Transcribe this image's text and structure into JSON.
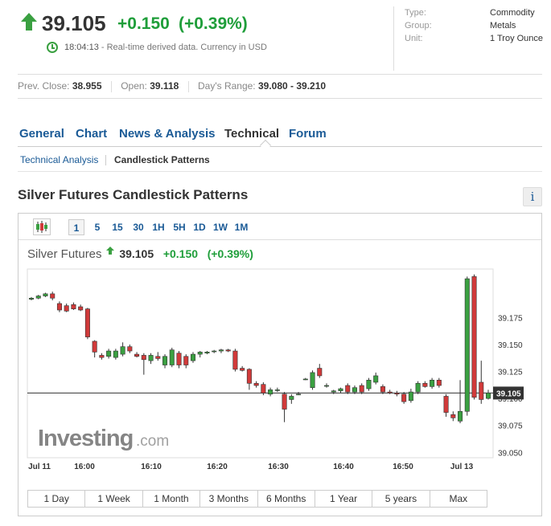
{
  "quote": {
    "price": "39.105",
    "change": "+0.150",
    "change_pct": "(+0.39%)",
    "time": "18:04:13",
    "time_note": " - Real-time derived data. Currency in USD"
  },
  "meta": [
    {
      "key": "Type:",
      "value": "Commodity"
    },
    {
      "key": "Group:",
      "value": "Metals"
    },
    {
      "key": "Unit:",
      "value": "1 Troy Ounce"
    }
  ],
  "stats": {
    "prev_close_label": "Prev. Close:",
    "prev_close": "38.955",
    "open_label": "Open:",
    "open": "39.118",
    "range_label": "Day's Range:",
    "range": "39.080 - 39.210"
  },
  "tabs": [
    "General",
    "Chart",
    "News & Analysis",
    "Technical",
    "Forum"
  ],
  "subtabs": {
    "analysis": "Technical Analysis",
    "patterns": "Candlestick Patterns"
  },
  "section_title": "Silver Futures Candlestick Patterns",
  "info_label": "i",
  "toolbar": {
    "periods": [
      "1",
      "5",
      "15",
      "30",
      "1H",
      "5H",
      "1D",
      "1W",
      "1M"
    ],
    "active": "1"
  },
  "legend": {
    "name": "Silver Futures",
    "price": "39.105",
    "change": "+0.150",
    "change_pct": "(+0.39%)"
  },
  "ranges": [
    "1 Day",
    "1 Week",
    "1 Month",
    "3 Months",
    "6 Months",
    "1 Year",
    "5 years",
    "Max"
  ],
  "colors": {
    "up": "#3aa041",
    "down": "#d13a3a",
    "text_up": "#1f9e3a",
    "link": "#1a5a96"
  },
  "chart_data": {
    "type": "candlestick",
    "title": "Silver Futures",
    "ylim": [
      39.045,
      39.22
    ],
    "yticks": [
      "39.175",
      "39.150",
      "39.125",
      "39.100",
      "39.075",
      "39.050"
    ],
    "current_price": "39.105",
    "watermark": "Investing.com",
    "xticks": [
      "Jul 11",
      "16:00",
      "16:10",
      "16:20",
      "16:30",
      "16:40",
      "16:50",
      "Jul 13"
    ],
    "candles": [
      {
        "o": 39.192,
        "h": 39.194,
        "l": 39.191,
        "c": 39.193
      },
      {
        "o": 39.193,
        "h": 39.196,
        "l": 39.192,
        "c": 39.195
      },
      {
        "o": 39.195,
        "h": 39.198,
        "l": 39.194,
        "c": 39.197
      },
      {
        "o": 39.197,
        "h": 39.199,
        "l": 39.191,
        "c": 39.193
      },
      {
        "o": 39.188,
        "h": 39.19,
        "l": 39.18,
        "c": 39.182
      },
      {
        "o": 39.186,
        "h": 39.188,
        "l": 39.18,
        "c": 39.181
      },
      {
        "o": 39.187,
        "h": 39.189,
        "l": 39.182,
        "c": 39.183
      },
      {
        "o": 39.185,
        "h": 39.187,
        "l": 39.181,
        "c": 39.182
      },
      {
        "o": 39.183,
        "h": 39.184,
        "l": 39.155,
        "c": 39.157
      },
      {
        "o": 39.153,
        "h": 39.154,
        "l": 39.138,
        "c": 39.143
      },
      {
        "o": 39.14,
        "h": 39.142,
        "l": 39.136,
        "c": 39.138
      },
      {
        "o": 39.139,
        "h": 39.146,
        "l": 39.137,
        "c": 39.144
      },
      {
        "o": 39.138,
        "h": 39.146,
        "l": 39.136,
        "c": 39.144
      },
      {
        "o": 39.141,
        "h": 39.152,
        "l": 39.139,
        "c": 39.148
      },
      {
        "o": 39.148,
        "h": 39.15,
        "l": 39.142,
        "c": 39.144
      },
      {
        "o": 39.141,
        "h": 39.143,
        "l": 39.138,
        "c": 39.139
      },
      {
        "o": 39.14,
        "h": 39.142,
        "l": 39.122,
        "c": 39.136
      },
      {
        "o": 39.135,
        "h": 39.142,
        "l": 39.132,
        "c": 39.14
      },
      {
        "o": 39.139,
        "h": 39.143,
        "l": 39.135,
        "c": 39.137
      },
      {
        "o": 39.131,
        "h": 39.141,
        "l": 39.128,
        "c": 39.139
      },
      {
        "o": 39.131,
        "h": 39.147,
        "l": 39.129,
        "c": 39.145
      },
      {
        "o": 39.142,
        "h": 39.144,
        "l": 39.128,
        "c": 39.131
      },
      {
        "o": 39.139,
        "h": 39.141,
        "l": 39.128,
        "c": 39.131
      },
      {
        "o": 39.135,
        "h": 39.143,
        "l": 39.133,
        "c": 39.141
      },
      {
        "o": 39.141,
        "h": 39.144,
        "l": 39.138,
        "c": 39.143
      },
      {
        "o": 39.142,
        "h": 39.144,
        "l": 39.141,
        "c": 39.143
      },
      {
        "o": 39.144,
        "h": 39.145,
        "l": 39.142,
        "c": 39.144
      },
      {
        "o": 39.144,
        "h": 39.146,
        "l": 39.142,
        "c": 39.145
      },
      {
        "o": 39.145,
        "h": 39.146,
        "l": 39.143,
        "c": 39.144
      },
      {
        "o": 39.144,
        "h": 39.146,
        "l": 39.125,
        "c": 39.127
      },
      {
        "o": 39.128,
        "h": 39.13,
        "l": 39.125,
        "c": 39.126
      },
      {
        "o": 39.127,
        "h": 39.128,
        "l": 39.108,
        "c": 39.114
      },
      {
        "o": 39.114,
        "h": 39.116,
        "l": 39.11,
        "c": 39.112
      },
      {
        "o": 39.113,
        "h": 39.115,
        "l": 39.103,
        "c": 39.105
      },
      {
        "o": 39.104,
        "h": 39.11,
        "l": 39.102,
        "c": 39.108
      },
      {
        "o": 39.108,
        "h": 39.11,
        "l": 39.106,
        "c": 39.108
      },
      {
        "o": 39.104,
        "h": 39.106,
        "l": 39.078,
        "c": 39.09
      },
      {
        "o": 39.099,
        "h": 39.104,
        "l": 39.095,
        "c": 39.102
      },
      {
        "o": 39.104,
        "h": 39.106,
        "l": 39.103,
        "c": 39.104
      },
      {
        "o": 39.118,
        "h": 39.119,
        "l": 39.117,
        "c": 39.118
      },
      {
        "o": 39.11,
        "h": 39.126,
        "l": 39.108,
        "c": 39.124
      },
      {
        "o": 39.128,
        "h": 39.132,
        "l": 39.119,
        "c": 39.121
      },
      {
        "o": 39.112,
        "h": 39.114,
        "l": 39.11,
        "c": 39.112
      },
      {
        "o": 39.106,
        "h": 39.108,
        "l": 39.104,
        "c": 39.107
      },
      {
        "o": 39.107,
        "h": 39.11,
        "l": 39.105,
        "c": 39.109
      },
      {
        "o": 39.112,
        "h": 39.114,
        "l": 39.104,
        "c": 39.106
      },
      {
        "o": 39.106,
        "h": 39.112,
        "l": 39.104,
        "c": 39.11
      },
      {
        "o": 39.112,
        "h": 39.114,
        "l": 39.104,
        "c": 39.106
      },
      {
        "o": 39.109,
        "h": 39.119,
        "l": 39.107,
        "c": 39.117
      },
      {
        "o": 39.115,
        "h": 39.124,
        "l": 39.113,
        "c": 39.121
      },
      {
        "o": 39.111,
        "h": 39.113,
        "l": 39.104,
        "c": 39.106
      },
      {
        "o": 39.106,
        "h": 39.108,
        "l": 39.104,
        "c": 39.105
      },
      {
        "o": 39.105,
        "h": 39.107,
        "l": 39.102,
        "c": 39.104
      },
      {
        "o": 39.104,
        "h": 39.106,
        "l": 39.095,
        "c": 39.097
      },
      {
        "o": 39.098,
        "h": 39.109,
        "l": 39.096,
        "c": 39.106
      },
      {
        "o": 39.106,
        "h": 39.116,
        "l": 39.104,
        "c": 39.114
      },
      {
        "o": 39.114,
        "h": 39.116,
        "l": 39.11,
        "c": 39.111
      },
      {
        "o": 39.111,
        "h": 39.119,
        "l": 39.109,
        "c": 39.117
      },
      {
        "o": 39.117,
        "h": 39.119,
        "l": 39.11,
        "c": 39.112
      },
      {
        "o": 39.102,
        "h": 39.104,
        "l": 39.083,
        "c": 39.087
      },
      {
        "o": 39.085,
        "h": 39.088,
        "l": 39.079,
        "c": 39.082
      },
      {
        "o": 39.079,
        "h": 39.117,
        "l": 39.077,
        "c": 39.088
      },
      {
        "o": 39.088,
        "h": 39.213,
        "l": 39.084,
        "c": 39.211
      },
      {
        "o": 39.213,
        "h": 39.215,
        "l": 39.099,
        "c": 39.101
      },
      {
        "o": 39.115,
        "h": 39.135,
        "l": 39.095,
        "c": 39.099
      },
      {
        "o": 39.1,
        "h": 39.108,
        "l": 39.099,
        "c": 39.105
      }
    ]
  }
}
